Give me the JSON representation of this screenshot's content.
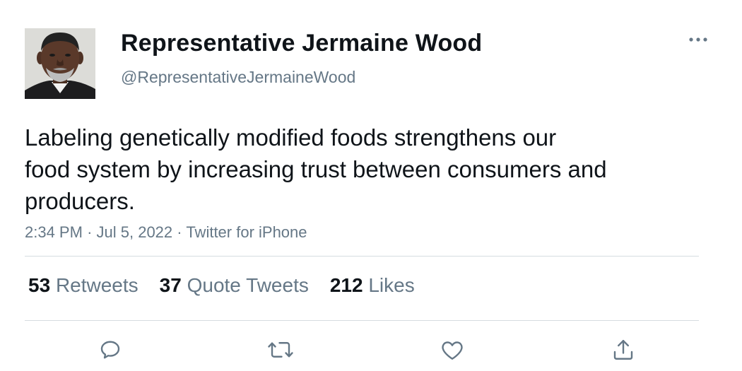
{
  "author": {
    "display_name": "Representative Jermaine Wood",
    "handle": "@RepresentativeJermaineWood",
    "avatar_icon": "profile-photo"
  },
  "tweet": {
    "text_lines": [
      "Labeling genetically modified foods strengthens our",
      "food system by increasing trust between consumers and",
      "producers."
    ],
    "time": "2:34 PM",
    "separator": "·",
    "date": "Jul 5, 2022",
    "source": "Twitter for iPhone"
  },
  "stats": {
    "retweets_count": "53",
    "retweets_label": "Retweets",
    "quotes_count": "37",
    "quotes_label": "Quote Tweets",
    "likes_count": "212",
    "likes_label": "Likes"
  },
  "icons": {
    "more": "more-icon",
    "reply": "reply-icon",
    "retweet": "retweet-icon",
    "like": "heart-icon",
    "share": "share-icon"
  },
  "colors": {
    "text_primary": "#0f1419",
    "text_secondary": "#657786",
    "divider": "#d6dce0"
  }
}
